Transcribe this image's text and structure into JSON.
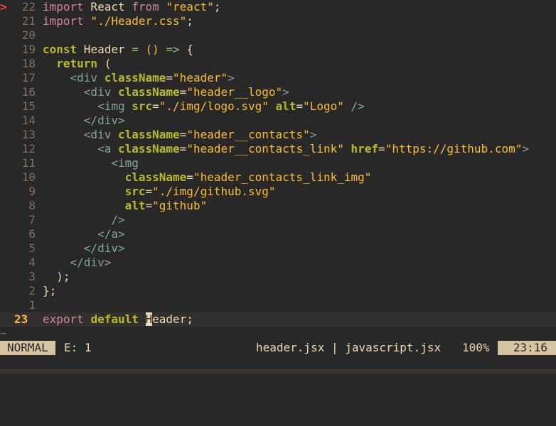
{
  "editor": {
    "sign_marker": ">",
    "lines": [
      {
        "num": "22",
        "tokens": [
          [
            "kw",
            "import"
          ],
          [
            "plain",
            " React "
          ],
          [
            "kw",
            "from"
          ],
          [
            "plain",
            " "
          ],
          [
            "str2",
            "\"react\""
          ],
          [
            "plain",
            ";"
          ]
        ]
      },
      {
        "num": "21",
        "tokens": [
          [
            "kw",
            "import"
          ],
          [
            "plain",
            " "
          ],
          [
            "str2",
            "\"./Header.css\""
          ],
          [
            "plain",
            ";"
          ]
        ]
      },
      {
        "num": "20",
        "tokens": []
      },
      {
        "num": "19",
        "tokens": [
          [
            "kw2",
            "const"
          ],
          [
            "plain",
            " Header "
          ],
          [
            "op",
            "="
          ],
          [
            "plain",
            " "
          ],
          [
            "str2",
            "()"
          ],
          [
            "plain",
            " "
          ],
          [
            "op",
            "=>"
          ],
          [
            "plain",
            " {"
          ]
        ]
      },
      {
        "num": "18",
        "tokens": [
          [
            "plain",
            "  "
          ],
          [
            "kw2",
            "return"
          ],
          [
            "plain",
            " ("
          ]
        ]
      },
      {
        "num": "17",
        "tokens": [
          [
            "plain",
            "    "
          ],
          [
            "tag",
            "<div"
          ],
          [
            "plain",
            " "
          ],
          [
            "attr",
            "className"
          ],
          [
            "plain",
            "="
          ],
          [
            "str2",
            "\"header\""
          ],
          [
            "tag",
            ">"
          ]
        ]
      },
      {
        "num": "16",
        "tokens": [
          [
            "plain",
            "      "
          ],
          [
            "tag",
            "<div"
          ],
          [
            "plain",
            " "
          ],
          [
            "attr",
            "className"
          ],
          [
            "plain",
            "="
          ],
          [
            "str2",
            "\"header__logo\""
          ],
          [
            "tag",
            ">"
          ]
        ]
      },
      {
        "num": "15",
        "tokens": [
          [
            "plain",
            "        "
          ],
          [
            "tag",
            "<img"
          ],
          [
            "plain",
            " "
          ],
          [
            "attr",
            "src"
          ],
          [
            "plain",
            "="
          ],
          [
            "str2",
            "\"./img/logo.svg\""
          ],
          [
            "plain",
            " "
          ],
          [
            "attr",
            "alt"
          ],
          [
            "plain",
            "="
          ],
          [
            "str2",
            "\"Logo\""
          ],
          [
            "plain",
            " "
          ],
          [
            "tag",
            "/>"
          ]
        ]
      },
      {
        "num": "14",
        "tokens": [
          [
            "plain",
            "      "
          ],
          [
            "tag",
            "</div>"
          ]
        ]
      },
      {
        "num": "13",
        "tokens": [
          [
            "plain",
            "      "
          ],
          [
            "tag",
            "<div"
          ],
          [
            "plain",
            " "
          ],
          [
            "attr",
            "className"
          ],
          [
            "plain",
            "="
          ],
          [
            "str2",
            "\"header__contacts\""
          ],
          [
            "tag",
            ">"
          ]
        ]
      },
      {
        "num": "12",
        "tokens": [
          [
            "plain",
            "        "
          ],
          [
            "tag",
            "<a"
          ],
          [
            "plain",
            " "
          ],
          [
            "attr",
            "className"
          ],
          [
            "plain",
            "="
          ],
          [
            "str2",
            "\"header__contacts_link\""
          ],
          [
            "plain",
            " "
          ],
          [
            "attr",
            "href"
          ],
          [
            "plain",
            "="
          ],
          [
            "str2",
            "\"https://github.com\""
          ],
          [
            "tag",
            ">"
          ]
        ]
      },
      {
        "num": "11",
        "tokens": [
          [
            "plain",
            "          "
          ],
          [
            "tag",
            "<img"
          ]
        ]
      },
      {
        "num": "10",
        "tokens": [
          [
            "plain",
            "            "
          ],
          [
            "attr",
            "className"
          ],
          [
            "plain",
            "="
          ],
          [
            "str2",
            "\"header_contacts_link_img\""
          ]
        ]
      },
      {
        "num": "9",
        "tokens": [
          [
            "plain",
            "            "
          ],
          [
            "attr",
            "src"
          ],
          [
            "plain",
            "="
          ],
          [
            "str2",
            "\"./img/github.svg\""
          ]
        ]
      },
      {
        "num": "8",
        "tokens": [
          [
            "plain",
            "            "
          ],
          [
            "attr",
            "alt"
          ],
          [
            "plain",
            "="
          ],
          [
            "str2",
            "\"github\""
          ]
        ]
      },
      {
        "num": "7",
        "tokens": [
          [
            "plain",
            "          "
          ],
          [
            "tag",
            "/>"
          ]
        ]
      },
      {
        "num": "6",
        "tokens": [
          [
            "plain",
            "        "
          ],
          [
            "tag",
            "</a>"
          ]
        ]
      },
      {
        "num": "5",
        "tokens": [
          [
            "plain",
            "      "
          ],
          [
            "tag",
            "</div>"
          ]
        ]
      },
      {
        "num": "4",
        "tokens": [
          [
            "plain",
            "    "
          ],
          [
            "tag",
            "</div>"
          ]
        ]
      },
      {
        "num": "3",
        "tokens": [
          [
            "plain",
            "  );"
          ]
        ]
      },
      {
        "num": "2",
        "tokens": [
          [
            "plain",
            "};"
          ]
        ]
      },
      {
        "num": "1",
        "tokens": []
      },
      {
        "num": "23",
        "current": true,
        "tokens": [
          [
            "kw",
            "export"
          ],
          [
            "plain",
            " "
          ],
          [
            "kw2",
            "default"
          ],
          [
            "plain",
            " "
          ],
          [
            "cursor",
            "H"
          ],
          [
            "plain",
            "eader;"
          ]
        ]
      }
    ],
    "tilde": "~"
  },
  "statusline": {
    "mode": "NORMAL",
    "errors": "E: 1",
    "fileinfo": "header.jsx | javascript.jsx",
    "percent": "100%",
    "position": "23:16"
  },
  "colors": {
    "background": "#282828",
    "foreground": "#ebdbb2",
    "keyword": "#d3869b",
    "string": "#fabd2f",
    "tag": "#83a598",
    "attribute": "#b8bb26",
    "operator": "#8ec07c",
    "line_number": "#7c6f64",
    "current_line_number": "#fabd2f",
    "sign": "#fb4934",
    "mode_bg": "#d5c4a1"
  }
}
